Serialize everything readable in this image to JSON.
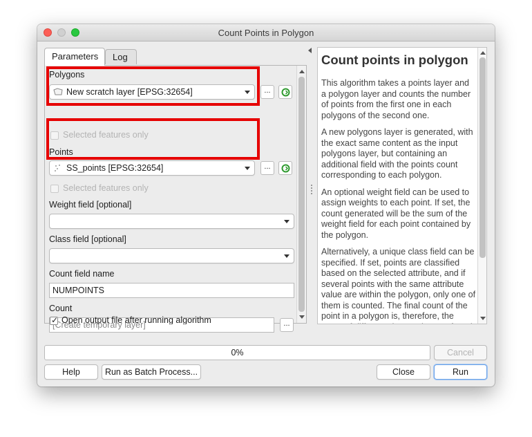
{
  "window": {
    "title": "Count Points in Polygon"
  },
  "tabs": [
    {
      "label": "Parameters",
      "active": true
    },
    {
      "label": "Log",
      "active": false
    }
  ],
  "parameters": {
    "polygons_label": "Polygons",
    "polygons_value": "New scratch layer [EPSG:32654]",
    "polygons_selected_only": "Selected features only",
    "points_label": "Points",
    "points_value": "SS_points [EPSG:32654]",
    "points_selected_only": "Selected features only",
    "weight_label": "Weight field [optional]",
    "weight_value": "",
    "class_label": "Class field [optional]",
    "class_value": "",
    "count_field_label": "Count field name",
    "count_field_value": "NUMPOINTS",
    "count_label": "Count",
    "count_placeholder": "[Create temporary layer]",
    "browse_label": "...",
    "open_output_label": "Open output file after running algorithm",
    "open_output_checked": true
  },
  "help": {
    "title": "Count points in polygon",
    "paragraphs": [
      "This algorithm takes a points layer and a polygon layer and counts the number of points from the first one in each polygons of the second one.",
      "A new polygons layer is generated, with the exact same content as the input polygons layer, but containing an additional field with the points count corresponding to each polygon.",
      "An optional weight field can be used to assign weights to each point. If set, the count generated will be the sum of the weight field for each point contained by the polygon.",
      "Alternatively, a unique class field can be specified. If set, points are classified based on the selected attribute, and if several points with the same attribute value are within the polygon, only one of them is counted. The final count of the point in a polygon is, therefore, the count of different classes that are found in it."
    ]
  },
  "progress": {
    "value": 0,
    "text": "0%"
  },
  "buttons": {
    "cancel": "Cancel",
    "help": "Help",
    "batch": "Run as Batch Process...",
    "close": "Close",
    "run": "Run"
  },
  "colors": {
    "highlight": "#e60000",
    "accent": "#6aa2e8",
    "refresh_green": "#2e9a2e"
  },
  "icons": {
    "polygon_layer": "polygon-layer-icon",
    "point_layer": "point-layer-icon",
    "iterate": "iterate-icon"
  }
}
